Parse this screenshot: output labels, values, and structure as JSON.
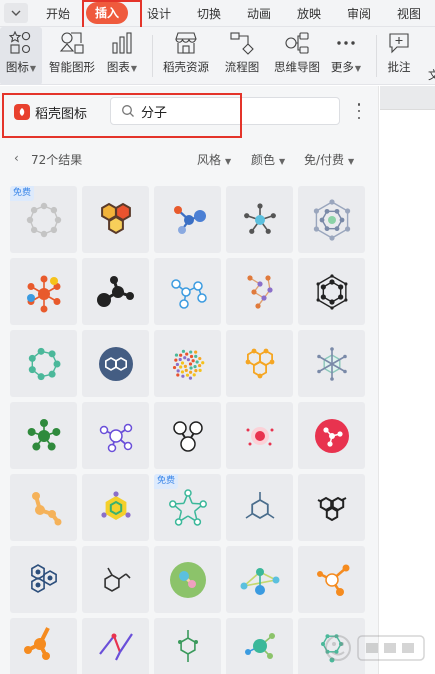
{
  "menu": {
    "tabs": [
      "开始",
      "插入",
      "设计",
      "切换",
      "动画",
      "放映",
      "审阅",
      "视图"
    ],
    "active_index": 1
  },
  "ribbon": {
    "icon_label": "图标",
    "smartart_label": "智能图形",
    "chart_label": "图表",
    "daoke_label": "稻壳资源",
    "flowchart_label": "流程图",
    "mindmap_label": "思维导图",
    "more_label": "更多",
    "comment_label": "批注",
    "partial_label": "文"
  },
  "panel": {
    "brand": "稻壳图标",
    "search_value": "分子",
    "result_count": "72个结果",
    "filters": [
      "风格",
      "颜色",
      "免/付费"
    ],
    "free_badge": "免费"
  },
  "colors": {
    "accent": "#ef5a3d",
    "highlight_box": "#e4342a",
    "badge_text": "#3a86e8"
  },
  "icons": [
    "ring-molecule-icon",
    "honeycomb-molecule-icon",
    "blue-molecule-icon",
    "lineart-molecule-icon",
    "hexagon-network-icon",
    "colorful-atom-icon",
    "black-molecule-icon",
    "blue-branch-molecule-icon",
    "orange-chain-molecule-icon",
    "benzene-ring-icon",
    "green-ring-icon",
    "benzene-circle-icon",
    "particles-icon",
    "orange-hexagons-icon",
    "teal-structure-icon",
    "green-molecule-icon",
    "purple-molecule-icon",
    "outline-molecule-icon",
    "pink-particle-icon",
    "red-circle-molecule-icon",
    "orange-connection-icon",
    "yellow-hexagon-molecule-icon",
    "green-star-molecule-icon",
    "chemical-formula-icon",
    "black-hexagon-network-icon",
    "abc-hexagon-icon",
    "structural-formula-icon",
    "green-circle-molecule-icon",
    "green-fan-molecule-icon",
    "orange-atom-icon",
    "orange-molecule-partial-icon",
    "purple-zigzag-icon",
    "green-formula-icon",
    "green-network-icon",
    "teal-partial-icon"
  ],
  "badge_tiles": [
    0,
    22
  ]
}
